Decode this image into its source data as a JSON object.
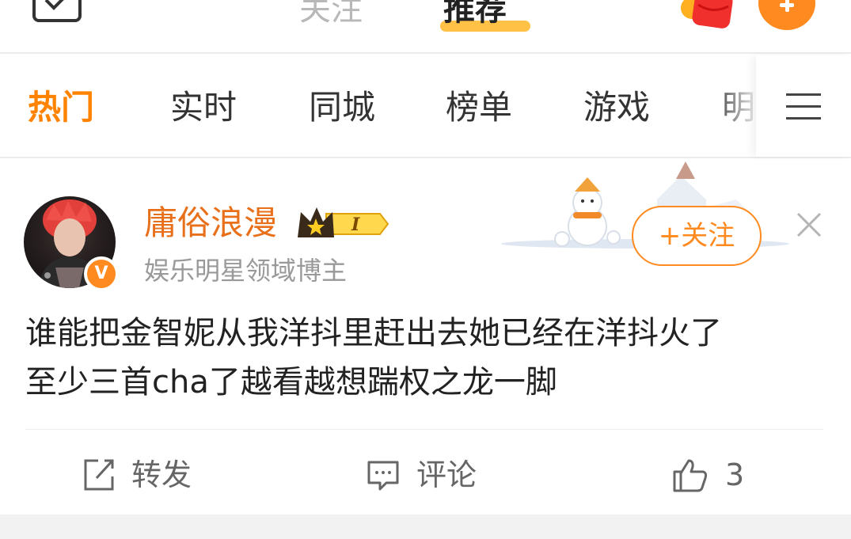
{
  "topbar": {
    "follow_tab": "关注",
    "recommend_tab": "推荐",
    "icons": [
      "compose-icon",
      "red-packet-icon",
      "add-icon"
    ],
    "accent_color": "#ff8200"
  },
  "channels": {
    "items": [
      {
        "label": "热门",
        "active": true
      },
      {
        "label": "实时",
        "active": false
      },
      {
        "label": "同城",
        "active": false
      },
      {
        "label": "榜单",
        "active": false
      },
      {
        "label": "游戏",
        "active": false
      },
      {
        "label": "明",
        "active": false
      }
    ],
    "menu_icon": "hamburger-icon"
  },
  "post": {
    "username": "庸俗浪漫",
    "vip_level": "I",
    "user_desc": "娱乐明星领域博主",
    "verify_badge": "V",
    "follow_button": "+关注",
    "content_lines": [
      "谁能把金智妮从我洋抖里赶出去她已经在洋抖火了",
      "至少三首cha了越看越想踹权之龙一脚"
    ],
    "actions": {
      "repost": "转发",
      "comment": "评论",
      "like_count": "3"
    }
  }
}
